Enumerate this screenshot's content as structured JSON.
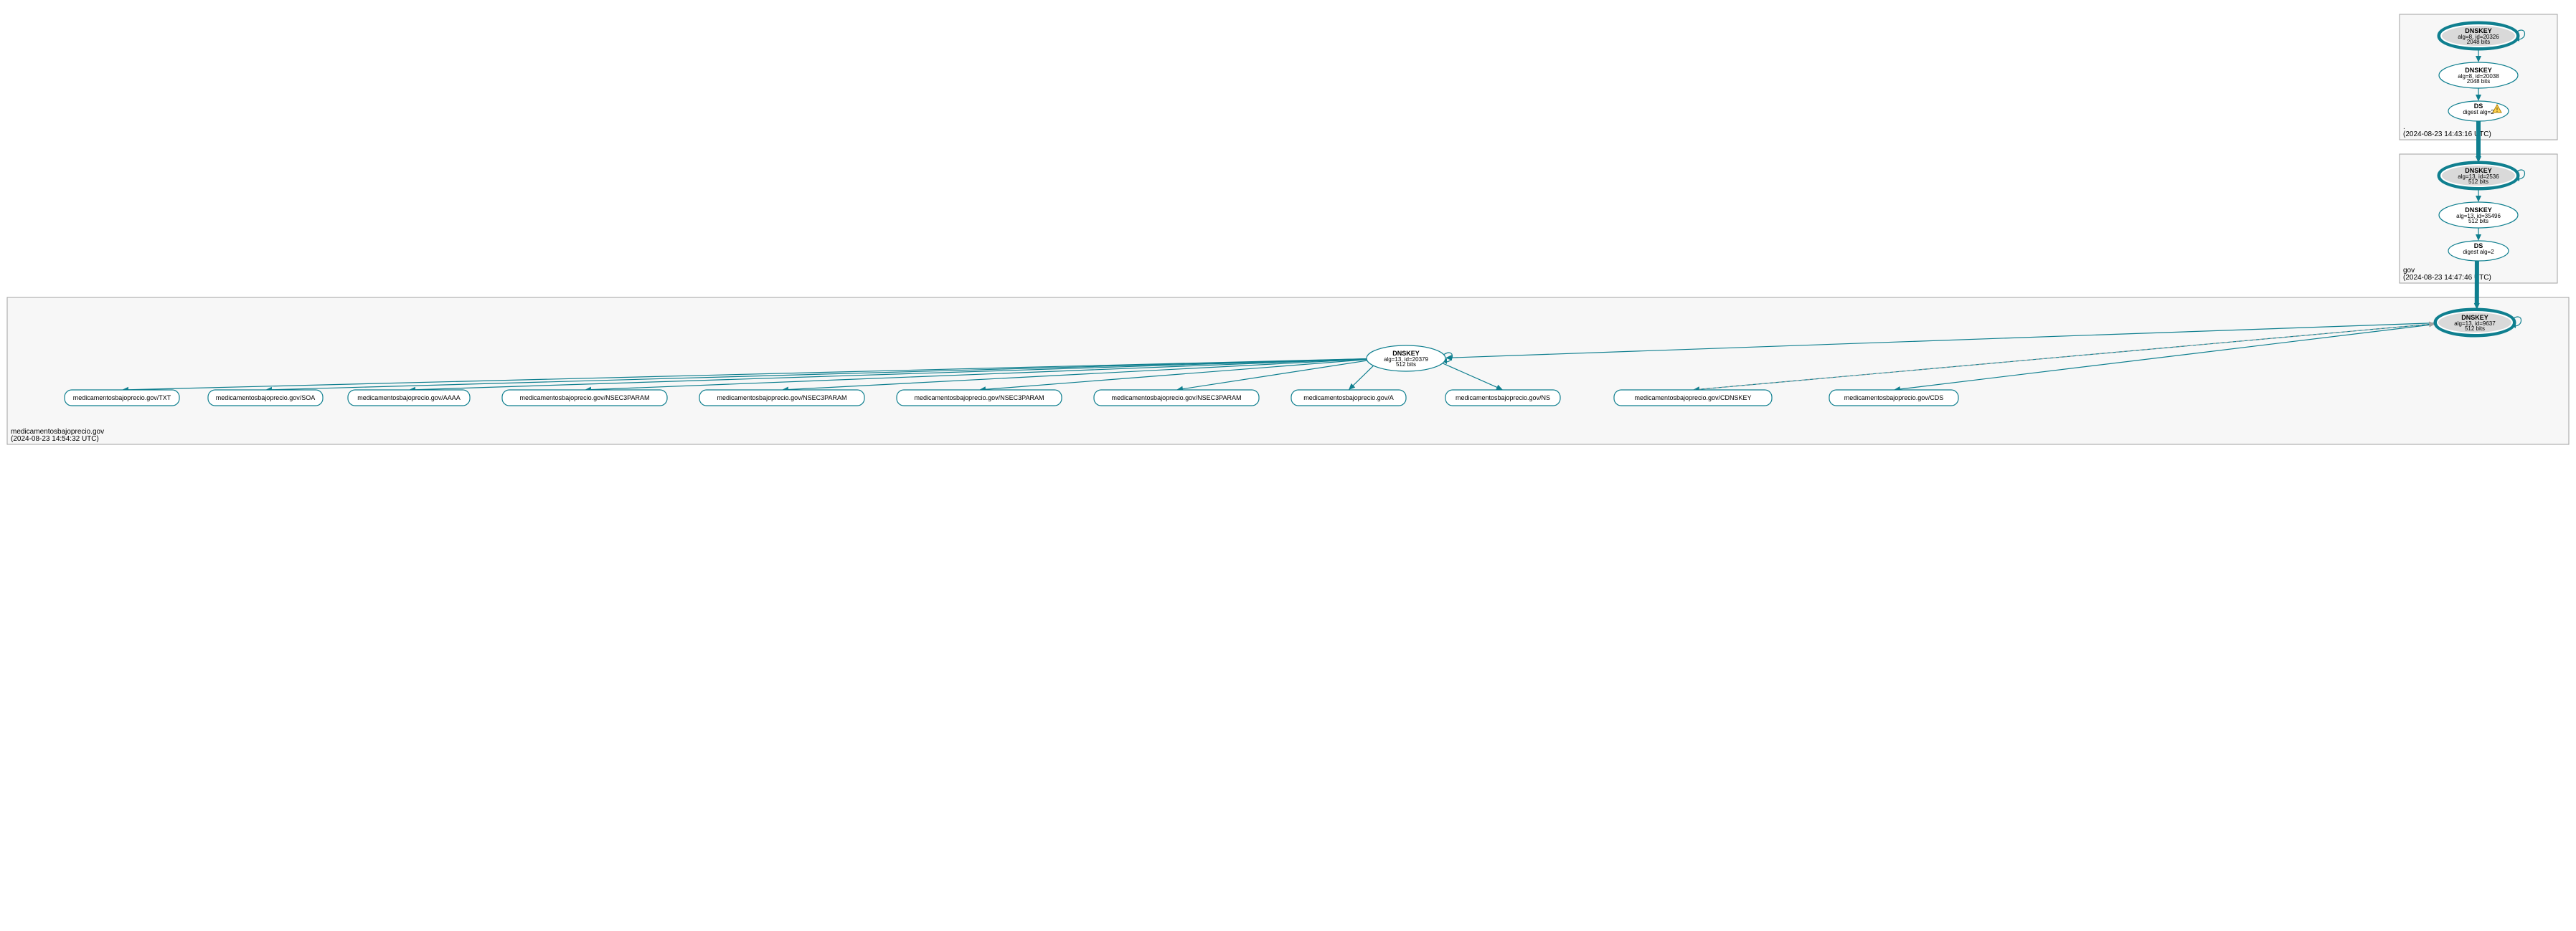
{
  "chart_data": {
    "type": "graph",
    "zones": [
      {
        "id": "root",
        "label": ".",
        "timestamp": "(2024-08-23 14:43:16 UTC)",
        "nodes": [
          {
            "id": "rk1",
            "kind": "dnskey",
            "ksk": true,
            "l1": "DNSKEY",
            "l2": "alg=8, id=20326",
            "l3": "2048 bits"
          },
          {
            "id": "rk2",
            "kind": "dnskey",
            "ksk": false,
            "l1": "DNSKEY",
            "l2": "alg=8, id=20038",
            "l3": "2048 bits"
          },
          {
            "id": "rds",
            "kind": "ds",
            "warn": true,
            "l1": "DS",
            "l2": "digest alg=2"
          }
        ]
      },
      {
        "id": "gov",
        "label": "gov",
        "timestamp": "(2024-08-23 14:47:46 UTC)",
        "nodes": [
          {
            "id": "gk1",
            "kind": "dnskey",
            "ksk": true,
            "l1": "DNSKEY",
            "l2": "alg=13, id=2536",
            "l3": "512 bits"
          },
          {
            "id": "gk2",
            "kind": "dnskey",
            "ksk": false,
            "l1": "DNSKEY",
            "l2": "alg=13, id=35496",
            "l3": "512 bits"
          },
          {
            "id": "gds",
            "kind": "ds",
            "warn": false,
            "l1": "DS",
            "l2": "digest alg=2"
          }
        ]
      },
      {
        "id": "domain",
        "label": "medicamentosbajoprecio.gov",
        "timestamp": "(2024-08-23 14:54:32 UTC)",
        "nodes": [
          {
            "id": "dk1",
            "kind": "dnskey",
            "ksk": true,
            "l1": "DNSKEY",
            "l2": "alg=13, id=9637",
            "l3": "512 bits"
          },
          {
            "id": "dk2",
            "kind": "dnskey",
            "ksk": false,
            "l1": "DNSKEY",
            "l2": "alg=13, id=20379",
            "l3": "512 bits"
          }
        ]
      }
    ],
    "rrsets": [
      {
        "id": "rr0",
        "label": "medicamentosbajoprecio.gov/TXT"
      },
      {
        "id": "rr1",
        "label": "medicamentosbajoprecio.gov/SOA"
      },
      {
        "id": "rr2",
        "label": "medicamentosbajoprecio.gov/AAAA"
      },
      {
        "id": "rr3",
        "label": "medicamentosbajoprecio.gov/NSEC3PARAM"
      },
      {
        "id": "rr4",
        "label": "medicamentosbajoprecio.gov/NSEC3PARAM"
      },
      {
        "id": "rr5",
        "label": "medicamentosbajoprecio.gov/NSEC3PARAM"
      },
      {
        "id": "rr6",
        "label": "medicamentosbajoprecio.gov/NSEC3PARAM"
      },
      {
        "id": "rr7",
        "label": "medicamentosbajoprecio.gov/A"
      },
      {
        "id": "rr8",
        "label": "medicamentosbajoprecio.gov/NS"
      },
      {
        "id": "rr9",
        "label": "medicamentosbajoprecio.gov/CDNSKEY"
      },
      {
        "id": "rr10",
        "label": "medicamentosbajoprecio.gov/CDS"
      }
    ],
    "edges": [
      {
        "from": "rk1",
        "to": "rk1",
        "self": true
      },
      {
        "from": "rk1",
        "to": "rk2"
      },
      {
        "from": "rk2",
        "to": "rds"
      },
      {
        "from": "rds",
        "to": "gk1",
        "strong": true
      },
      {
        "from": "gk1",
        "to": "gk1",
        "self": true
      },
      {
        "from": "gk1",
        "to": "gk2"
      },
      {
        "from": "gk2",
        "to": "gds"
      },
      {
        "from": "gds",
        "to": "dk1",
        "strong": true
      },
      {
        "from": "dk1",
        "to": "dk1",
        "self": true
      },
      {
        "from": "dk1",
        "to": "dk2"
      },
      {
        "from": "dk2",
        "to": "dk2",
        "self": true
      },
      {
        "from": "dk2",
        "to": "rr0"
      },
      {
        "from": "dk2",
        "to": "rr1"
      },
      {
        "from": "dk2",
        "to": "rr2"
      },
      {
        "from": "dk2",
        "to": "rr3"
      },
      {
        "from": "dk2",
        "to": "rr4"
      },
      {
        "from": "dk2",
        "to": "rr5"
      },
      {
        "from": "dk2",
        "to": "rr6"
      },
      {
        "from": "dk2",
        "to": "rr7"
      },
      {
        "from": "dk2",
        "to": "rr8"
      },
      {
        "from": "dk1",
        "to": "rr9"
      },
      {
        "from": "dk1",
        "to": "rr10"
      },
      {
        "from": "rr9",
        "to": "dk1",
        "dashed": true
      }
    ]
  }
}
